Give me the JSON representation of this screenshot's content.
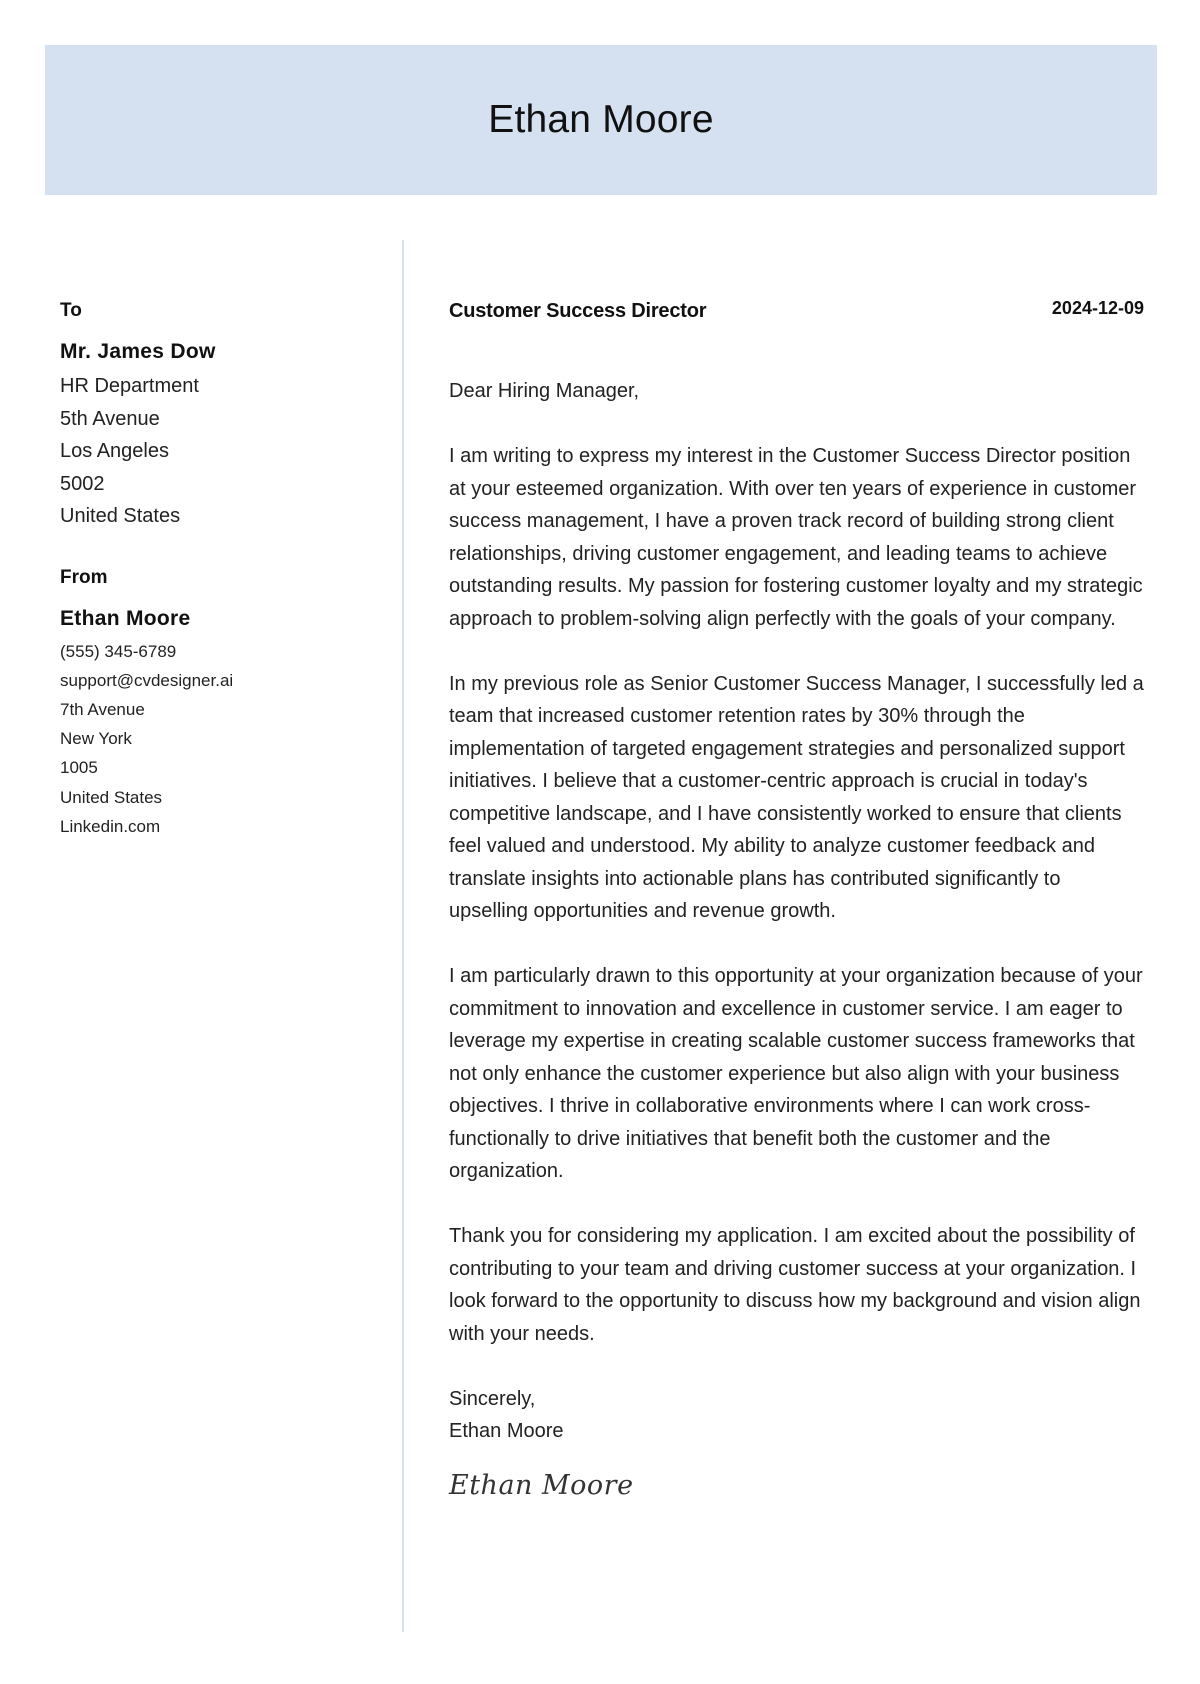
{
  "header": {
    "name": "Ethan Moore"
  },
  "recipient": {
    "label": "To",
    "name": "Mr. James Dow",
    "lines": [
      "HR Department",
      "5th Avenue",
      "Los Angeles",
      "5002",
      "United States"
    ]
  },
  "sender": {
    "label": "From",
    "name": "Ethan Moore",
    "lines": [
      "(555) 345-6789",
      "support@cvdesigner.ai",
      "7th Avenue",
      "New York",
      "1005",
      "United States",
      "Linkedin.com"
    ]
  },
  "letter": {
    "job_title": "Customer Success Director",
    "date": "2024-12-09",
    "greeting": "Dear Hiring Manager,",
    "paragraphs": [
      "I am writing to express my interest in the Customer Success Director position at your esteemed organization. With over ten years of experience in customer success management, I have a proven track record of building strong client relationships, driving customer engagement, and leading teams to achieve outstanding results. My passion for fostering customer loyalty and my strategic approach to problem-solving align perfectly with the goals of your company.",
      "In my previous role as Senior Customer Success Manager, I successfully led a team that increased customer retention rates by 30% through the implementation of targeted engagement strategies and personalized support initiatives. I believe that a customer-centric approach is crucial in today's competitive landscape, and I have consistently worked to ensure that clients feel valued and understood. My ability to analyze customer feedback and translate insights into actionable plans has contributed significantly to upselling opportunities and revenue growth.",
      "I am particularly drawn to this opportunity at your organization because of your commitment to innovation and excellence in customer service. I am eager to leverage my expertise in creating scalable customer success frameworks that not only enhance the customer experience but also align with your business objectives. I thrive in collaborative environments where I can work cross-functionally to drive initiatives that benefit both the customer and the organization.",
      "Thank you for considering my application. I am excited about the possibility of contributing to your team and driving customer success at your organization. I look forward to the opportunity to discuss how my background and vision align with your needs."
    ],
    "closing": "Sincerely,",
    "closing_name": "Ethan Moore",
    "signature": "Ethan Moore"
  },
  "colors": {
    "header_bg": "#d5e1f0",
    "divider": "#d4e2f2"
  }
}
